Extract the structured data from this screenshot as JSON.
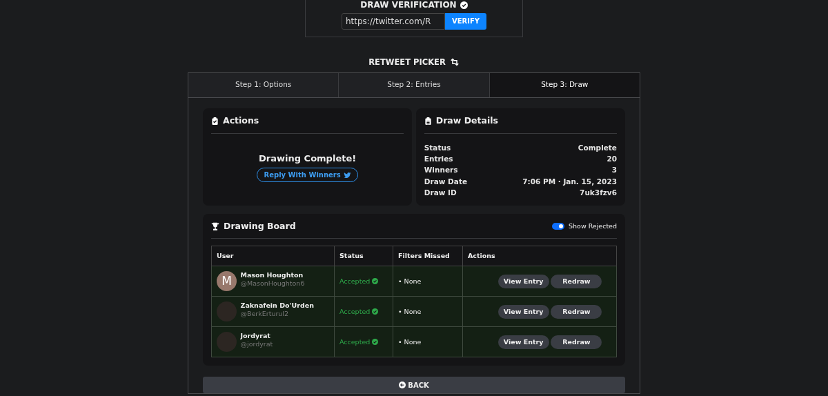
{
  "verification": {
    "title": "DRAW VERIFICATION",
    "url": "https://twitter.com/R",
    "button": "VERIFY"
  },
  "picker_title": "RETWEET PICKER",
  "tabs": [
    {
      "label": "Step 1: Options",
      "selected": false
    },
    {
      "label": "Step 2: Entries",
      "selected": false
    },
    {
      "label": "Step 3: Draw",
      "selected": true
    }
  ],
  "actions": {
    "title": "Actions",
    "message": "Drawing Complete!",
    "button": "Reply With Winners"
  },
  "draw_details": {
    "title": "Draw Details",
    "rows": [
      {
        "label": "Status",
        "value": "Complete"
      },
      {
        "label": "Entries",
        "value": "20"
      },
      {
        "label": "Winners",
        "value": "3"
      },
      {
        "label": "Draw Date",
        "value": "7:06 PM · Jan. 15, 2023"
      },
      {
        "label": "Draw ID",
        "value": "7uk3fzv6"
      }
    ]
  },
  "board": {
    "title": "Drawing Board",
    "toggle": {
      "label": "Show Rejected",
      "on": true
    },
    "columns": [
      "User",
      "Status",
      "Filters Missed",
      "Actions"
    ],
    "rows": [
      {
        "avatar": {
          "kind": "letter",
          "letter": "M"
        },
        "name": "Mason Houghton",
        "handle": "@MasonHoughton6",
        "status": "Accepted",
        "filters": "• None",
        "buttons": [
          "View Entry",
          "Redraw"
        ]
      },
      {
        "avatar": {
          "kind": "photo"
        },
        "name": "Zaknafein Do'Urden",
        "handle": "@BerkErturul2",
        "status": "Accepted",
        "filters": "• None",
        "buttons": [
          "View Entry",
          "Redraw"
        ]
      },
      {
        "avatar": {
          "kind": "photo"
        },
        "name": "Jordyrat",
        "handle": "@jordyrat",
        "status": "Accepted",
        "filters": "• None",
        "buttons": [
          "View Entry",
          "Redraw"
        ]
      }
    ]
  },
  "back_button": "BACK"
}
